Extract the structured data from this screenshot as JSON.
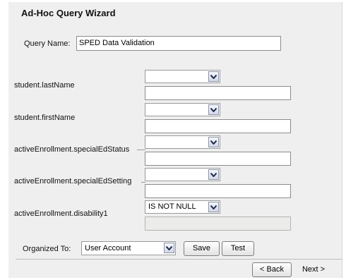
{
  "wizard": {
    "title": "Ad-Hoc Query Wizard",
    "query_name_label": "Query Name:",
    "query_name_value": "SPED Data Validation"
  },
  "fields": [
    {
      "label": "student.lastName",
      "operator": "",
      "value": ""
    },
    {
      "label": "student.firstName",
      "operator": "",
      "value": ""
    },
    {
      "label": "activeEnrollment.specialEdStatus",
      "operator": "",
      "value": ""
    },
    {
      "label": "activeEnrollment.specialEdSetting",
      "operator": "",
      "value": ""
    },
    {
      "label": "activeEnrollment.disability1",
      "operator": "IS NOT NULL",
      "value": ""
    }
  ],
  "organize": {
    "label": "Organized To:",
    "selected": "User Account",
    "save_label": "Save",
    "test_label": "Test"
  },
  "nav": {
    "back_label": "< Back",
    "next_label": "Next >"
  },
  "icons": {
    "dropdown": "chevron-down-icon"
  }
}
